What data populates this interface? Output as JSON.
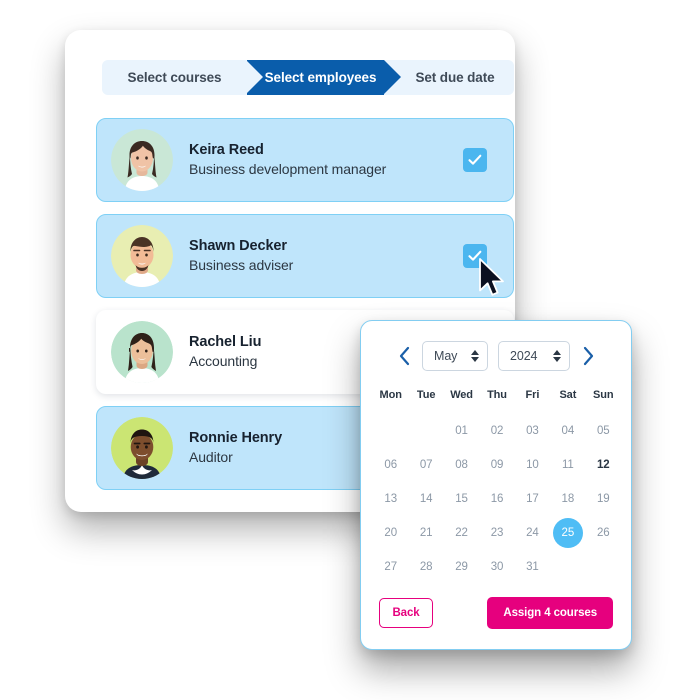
{
  "colors": {
    "active_step_bg": "#0a5dab",
    "stepper_bg": "#eaf4fd",
    "selected_row_bg": "#bfe5fb",
    "selected_row_border": "#7fd0f5",
    "checkbox_blue": "#4bb6ef",
    "calendar_border": "#83cdf1",
    "selected_day_blue": "#4fbdf5",
    "accent_pink": "#e6007e",
    "nav_arrow_blue": "#1a5fa8"
  },
  "stepper": {
    "steps": [
      {
        "label": "Select courses",
        "state": "done"
      },
      {
        "label": "Select employees",
        "state": "active"
      },
      {
        "label": "Set due date",
        "state": "upcoming"
      }
    ]
  },
  "employees": [
    {
      "name": "Keira Reed",
      "role": "Business development manager",
      "selected": true,
      "avatar_bg": "#c9e7d6",
      "avatar_name": "avatar-keira-reed"
    },
    {
      "name": "Shawn Decker",
      "role": "Business adviser",
      "selected": true,
      "avatar_bg": "#e8eeb2",
      "avatar_name": "avatar-shawn-decker"
    },
    {
      "name": "Rachel Liu",
      "role": "Accounting",
      "selected": false,
      "avatar_bg": "#b9e3cc",
      "avatar_name": "avatar-rachel-liu"
    },
    {
      "name": "Ronnie Henry",
      "role": "Auditor",
      "selected": true,
      "avatar_bg": "#cbe573",
      "avatar_name": "avatar-ronnie-henry"
    }
  ],
  "calendar": {
    "prev_icon": "chevron-left-icon",
    "next_icon": "chevron-right-icon",
    "month": "May",
    "year": "2024",
    "weekdays": [
      "Mon",
      "Tue",
      "Wed",
      "Thu",
      "Fri",
      "Sat",
      "Sun"
    ],
    "leading_blanks": 2,
    "days": [
      "01",
      "02",
      "03",
      "04",
      "05",
      "06",
      "07",
      "08",
      "09",
      "10",
      "11",
      "12",
      "13",
      "14",
      "15",
      "16",
      "17",
      "18",
      "19",
      "20",
      "21",
      "22",
      "23",
      "24",
      "25",
      "26",
      "27",
      "28",
      "29",
      "30",
      "31"
    ],
    "today": "12",
    "selected_day": "25",
    "back_label": "Back",
    "assign_label": "Assign 4 courses"
  },
  "cursor": {
    "icon": "mouse-pointer-icon"
  }
}
